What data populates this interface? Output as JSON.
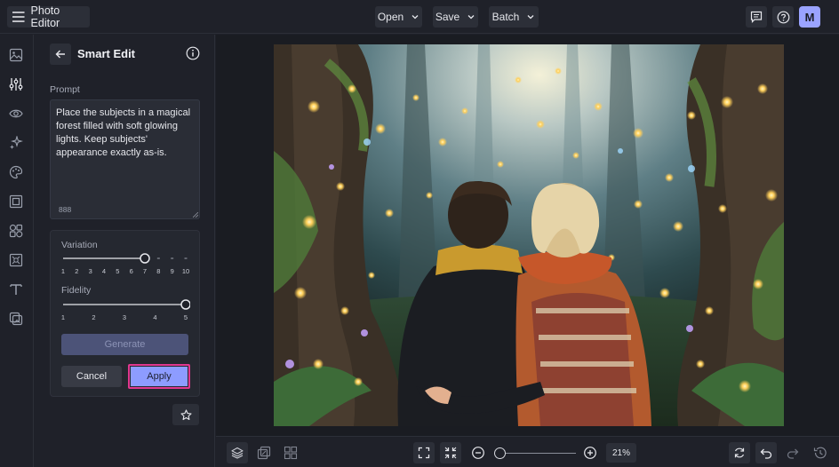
{
  "app": {
    "title": "Photo Editor",
    "avatar_initial": "M",
    "accent": "#8d9cff"
  },
  "topbar": {
    "menus": [
      {
        "label": "Open"
      },
      {
        "label": "Save"
      },
      {
        "label": "Batch"
      }
    ],
    "right_icons": [
      "feedback-icon",
      "help-icon"
    ]
  },
  "rail": {
    "icons": [
      "image-icon",
      "adjust-sliders-icon",
      "eye-icon",
      "sparkle-effects-icon",
      "palette-icon",
      "frame-icon",
      "shapes-icon",
      "texture-icon",
      "text-icon",
      "layers-graphic-icon"
    ]
  },
  "panel": {
    "title": "Smart Edit",
    "prompt_label": "Prompt",
    "prompt_text": "Place the subjects in a magical forest filled with soft glowing lights. Keep subjects' appearance exactly as-is.",
    "prompt_count": "888",
    "variation": {
      "label": "Variation",
      "ticks": [
        "1",
        "2",
        "3",
        "4",
        "5",
        "6",
        "7",
        "8",
        "9",
        "10"
      ],
      "value": 7
    },
    "fidelity": {
      "label": "Fidelity",
      "ticks": [
        "1",
        "2",
        "3",
        "4",
        "5"
      ],
      "value": 5
    },
    "generate_label": "Generate",
    "cancel_label": "Cancel",
    "apply_label": "Apply"
  },
  "bottombar": {
    "zoom": "21%"
  }
}
